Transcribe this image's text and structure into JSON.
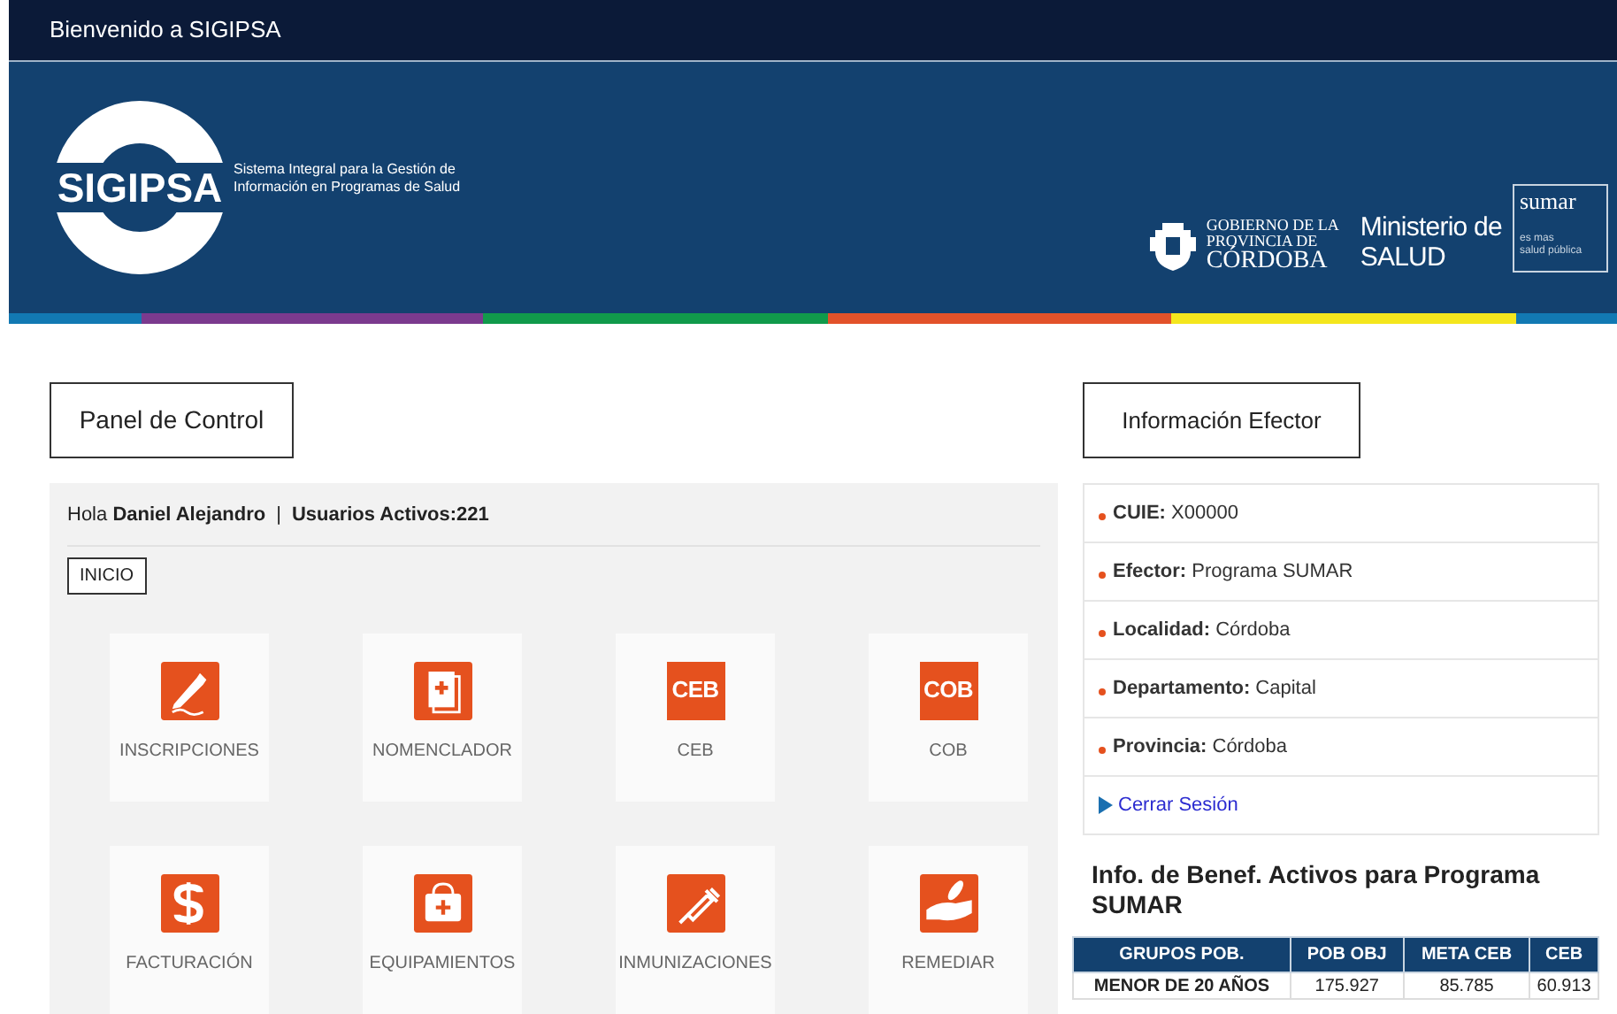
{
  "top_bar": {
    "title": "Bienvenido a SIGIPSA"
  },
  "banner": {
    "logo_text": "SIGIPSA",
    "subtitle": [
      "Sistema Integral para la Gestión de",
      "Información en Programas de Salud"
    ],
    "gobierno": [
      "GOBIERNO DE LA",
      "PROVINCIA DE",
      "CÓRDOBA"
    ],
    "ministerio": [
      "Ministerio de",
      "SALUD"
    ],
    "sumar": {
      "name": "sumar",
      "tagline": [
        "es mas",
        "salud pública"
      ]
    }
  },
  "stripe": [
    {
      "color": "#1279b3"
    },
    {
      "color": "#7b3a8e"
    },
    {
      "color": "#119a4b"
    },
    {
      "color": "#e2522a"
    },
    {
      "color": "#f4e61d"
    },
    {
      "color": "#1279b3"
    }
  ],
  "panel": {
    "title": "Panel de Control",
    "greeting": "Hola **Daniel Alejandro**",
    "separator": "|",
    "active_users": "Usuarios Activos:221",
    "breadcrumb": "INICIO",
    "tiles": [
      {
        "label": "INSCRIPCIONES"
      },
      {
        "label": "NOMENCLADOR"
      },
      {
        "label": "CEB",
        "icon_text": "CEB"
      },
      {
        "label": "COB",
        "icon_text": "COB"
      },
      {
        "label": "FACTURACIÓN"
      },
      {
        "label": "EQUIPAMIENTOS"
      },
      {
        "label": "INMUNIZACIONES"
      },
      {
        "label": "REMEDIAR"
      }
    ]
  },
  "efector": {
    "title": "Información Efector",
    "items": [
      {
        "label": "CUIE:",
        "value": "X00000"
      },
      {
        "label": "Efector:",
        "value": "Programa SUMAR"
      },
      {
        "label": "Localidad:",
        "value": "Córdoba"
      },
      {
        "label": "Departamento:",
        "value": "Capital"
      },
      {
        "label": "Provincia:",
        "value": "Córdoba"
      }
    ],
    "logout": "Cerrar Sesión"
  },
  "beneficiarios": {
    "title": "Info. de Benef. Activos para Programa SUMAR",
    "columns": [
      "GRUPOS POB.",
      "POB OBJ",
      "META CEB",
      "CEB"
    ],
    "rows": [
      [
        "MENOR DE 20 AÑOS",
        "175.927",
        "85.785",
        "60.913"
      ]
    ]
  }
}
